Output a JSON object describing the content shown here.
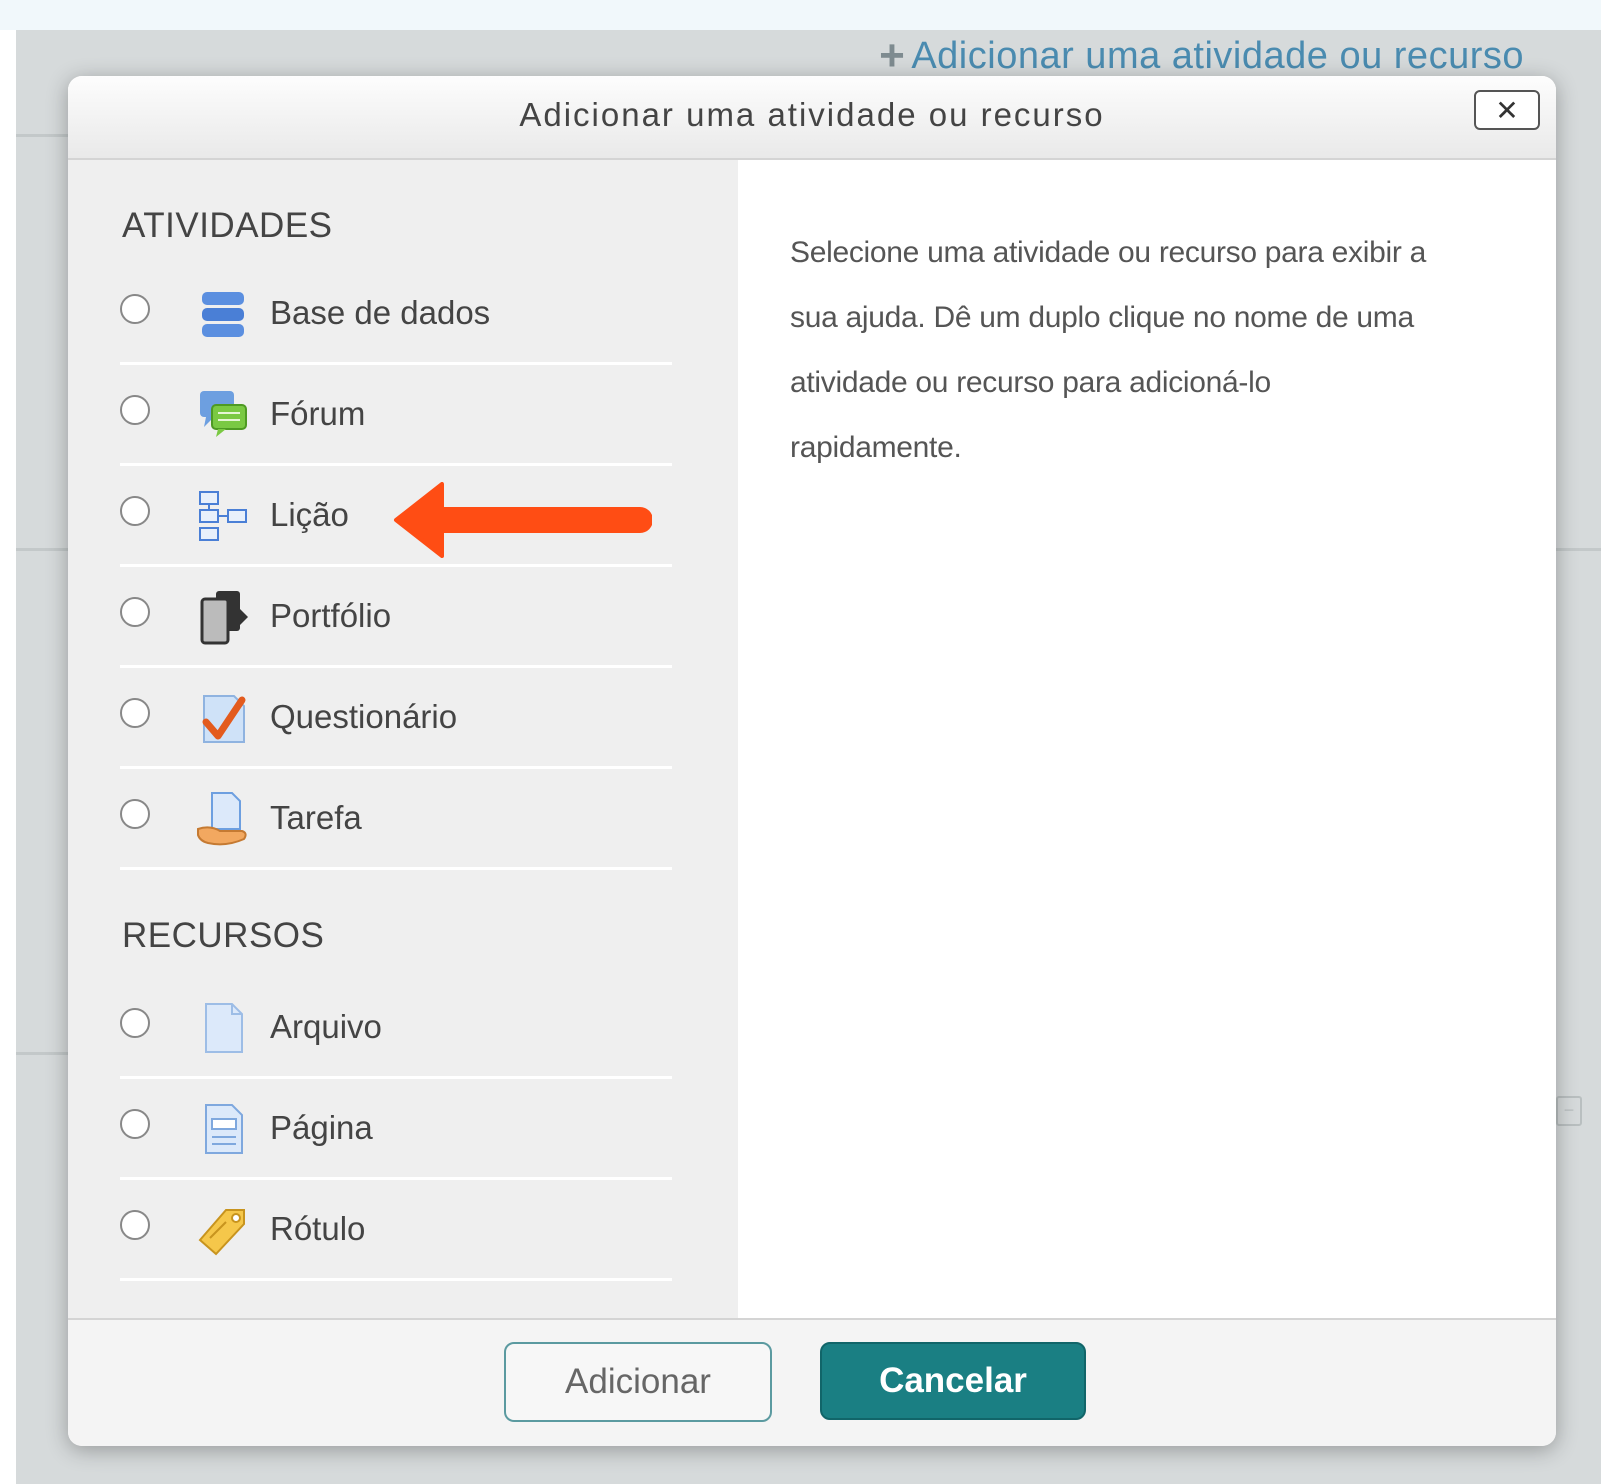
{
  "page": {
    "add_activity_link": "Adicionar uma atividade ou recurso"
  },
  "modal": {
    "title": "Adicionar uma atividade ou recurso",
    "close_symbol": "✕",
    "help_text": "Selecione uma atividade ou recurso para exibir a sua ajuda. Dê um duplo clique no nome de uma atividade ou recurso para adicioná-lo rapidamente.",
    "sections": [
      {
        "heading": "ATIVIDADES",
        "items": [
          {
            "label": "Base de dados",
            "icon": "database-icon",
            "selected": false
          },
          {
            "label": "Fórum",
            "icon": "forum-icon",
            "selected": false
          },
          {
            "label": "Lição",
            "icon": "lesson-icon",
            "selected": false
          },
          {
            "label": "Portfólio",
            "icon": "portfolio-icon",
            "selected": false
          },
          {
            "label": "Questionário",
            "icon": "quiz-icon",
            "selected": false
          },
          {
            "label": "Tarefa",
            "icon": "assignment-icon",
            "selected": false
          }
        ]
      },
      {
        "heading": "RECURSOS",
        "items": [
          {
            "label": "Arquivo",
            "icon": "file-icon",
            "selected": false
          },
          {
            "label": "Página",
            "icon": "page-icon",
            "selected": false
          },
          {
            "label": "Rótulo",
            "icon": "label-icon",
            "selected": false
          }
        ]
      }
    ],
    "buttons": {
      "add": "Adicionar",
      "cancel": "Cancelar"
    }
  },
  "colors": {
    "accent": "#1a7f83",
    "link": "#4a8bb0",
    "annotation_arrow": "#ff4d14"
  }
}
